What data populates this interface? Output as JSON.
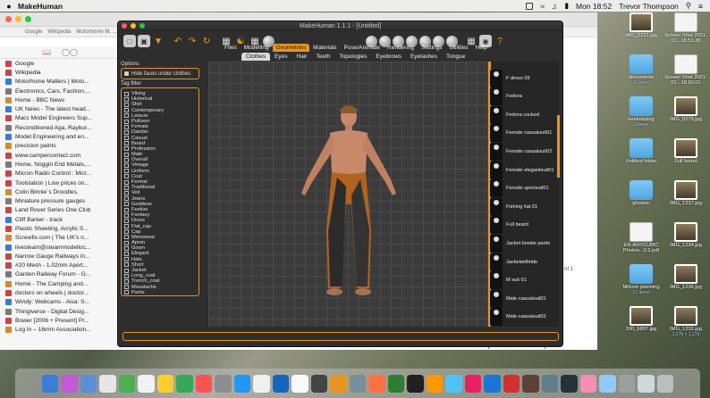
{
  "menubar": {
    "app_name": "MakeHuman",
    "clock": "Mon 18:52",
    "user": "Trevor Thompson"
  },
  "browser": {
    "bookmarks_bar": [
      "Google",
      "Wikipedia",
      "Motorhome M. ..."
    ],
    "page_count": "5 of 1",
    "bookmarks": [
      "Google",
      "Wikipedia",
      "Motorhome Matters | Moto...",
      "Electronics, Cars, Fashion,...",
      "Home - BBC News",
      "UK News - The latest head...",
      "Macc Model Engineers Sup...",
      "Reconditioned Aga, Raybur...",
      "Model Engineering and en...",
      "precision paints",
      "www.campercontact.com",
      "Home, Noggin End Metals,...",
      "Micron Radio Control : Micr...",
      "Toolstation | Low prices on...",
      "Colin Binnie`s Droodles.",
      "Miniature pressure gauges",
      "Land Rover Series One Club",
      "Cliff Barker - track",
      "Plastic Sheeting, Acrylic S...",
      "Screwfix.com | The UK's n...",
      "livesteam@steammodelloc...",
      "Narrow Gauge Railways in...",
      "#20 Mesh - 1.02mm Apert...",
      "Garden Railway Forum - G...",
      "Home - The Camping and...",
      "doctors on wheels | doctor...",
      "Windy: Webcams - Aisa: S...",
      "Thingiverse - Digital Desig...",
      "Bower [2006 + Present] Pr...",
      "Log In – 16mm Association..."
    ]
  },
  "makehuman": {
    "window_title": "MakeHuman 1.1.1 - [Untitled]",
    "main_tabs": [
      "Files",
      "Modelling",
      "Geometries",
      "Materials",
      "Pose/Animate",
      "Rendering",
      "Settings",
      "Utilities",
      "Help"
    ],
    "active_main_tab": "Geometries",
    "sub_tabs": [
      "Clothes",
      "Eyes",
      "Hair",
      "Teeth",
      "Topologies",
      "Eyebrows",
      "Eyelashes",
      "Tongue"
    ],
    "active_sub_tab": "Clothes",
    "options_label": "Options",
    "hide_faces_label": "Hide faces under clothes",
    "tag_filter_label": "Tag filter",
    "tags": [
      "Viking",
      "Historical",
      "Shirt",
      "Contemporary",
      "Leisure",
      "Pullover",
      "Female",
      "Dander",
      "Casual",
      "Beard",
      "Profession",
      "Male",
      "Overall",
      "Vintage",
      "Uniform",
      "Coat",
      "Formal",
      "Traditional",
      "Veil",
      "Jeans",
      "Goddess",
      "Festive",
      "Fantasy",
      "Dress",
      "Flat_cap",
      "Cap",
      "Menswear",
      "Apron",
      "Gown",
      "Elegant",
      "Hats",
      "Short",
      "Jacket",
      "Long_coat",
      "Trench_coat",
      "Moustache",
      "Pants",
      "Shoes",
      "Top"
    ],
    "clothes": [
      "F dress 09",
      "Fedora",
      "Fedora cocked",
      "Female casualsuit01",
      "Female casualsuit02",
      "Female elegantsuit01",
      "Female sportsuit01",
      "Fishing hat 01",
      "Full beard",
      "Jacket bowtie pants",
      "Jacketwithtide",
      "M suit 01",
      "Male casualsuit01",
      "Male casualsuit02"
    ]
  },
  "desktop_icons": [
    {
      "name": "IMG_1231.jpg",
      "sub": "",
      "kind": "photo"
    },
    {
      "name": "Screen Shot 2021-01...18.51.28",
      "sub": "",
      "kind": "doc"
    },
    {
      "name": "documents",
      "sub": "11 items",
      "kind": "folder"
    },
    {
      "name": "Screen Shot 2021-01...18.50.01",
      "sub": "",
      "kind": "doc"
    },
    {
      "name": "beekeeping",
      "sub": "2 items",
      "kind": "folder"
    },
    {
      "name": "IMG_0279.jpg",
      "sub": "",
      "kind": "photo"
    },
    {
      "name": "Untitled folder",
      "sub": "",
      "kind": "folder"
    },
    {
      "name": "Full beard",
      "sub": "",
      "kind": "photo"
    },
    {
      "name": "ghostsc",
      "sub": "",
      "kind": "folder"
    },
    {
      "name": "IMG_1237.jpg",
      "sub": "",
      "kind": "photo"
    },
    {
      "name": "EN-ANYCUBIC Photon...0.2.pdf",
      "sub": "",
      "kind": "doc"
    },
    {
      "name": "IMG_1234.jpg",
      "sub": "",
      "kind": "photo"
    },
    {
      "name": "Milcom planning",
      "sub": "17 items",
      "kind": "folder"
    },
    {
      "name": "IMG_1236.jpg",
      "sub": "",
      "kind": "photo"
    },
    {
      "name": "100_6897.jpg",
      "sub": "",
      "kind": "photo"
    },
    {
      "name": "IMG_1232.jpg",
      "sub": "1,276 × 1,276",
      "kind": "photo"
    }
  ],
  "dock_colors": [
    "#3b7dd8",
    "#c05bd6",
    "#5a8fd8",
    "#e6e6e6",
    "#4caf50",
    "#f2f2f2",
    "#ffcc33",
    "#34a853",
    "#ff5252",
    "#8e8e8e",
    "#2196f3",
    "#f0f0f0",
    "#1565c0",
    "#fafafa",
    "#444444",
    "#e69524",
    "#78909c",
    "#ff7043",
    "#2e7d32",
    "#212121",
    "#ff9800",
    "#4fc3f7",
    "#e91e63",
    "#1976d2",
    "#d32f2f",
    "#5d4037",
    "#607d8b",
    "#263238",
    "#f48fb1",
    "#90caf9",
    "#9e9e9e",
    "#cfd8dc",
    "#bdbdbd"
  ]
}
